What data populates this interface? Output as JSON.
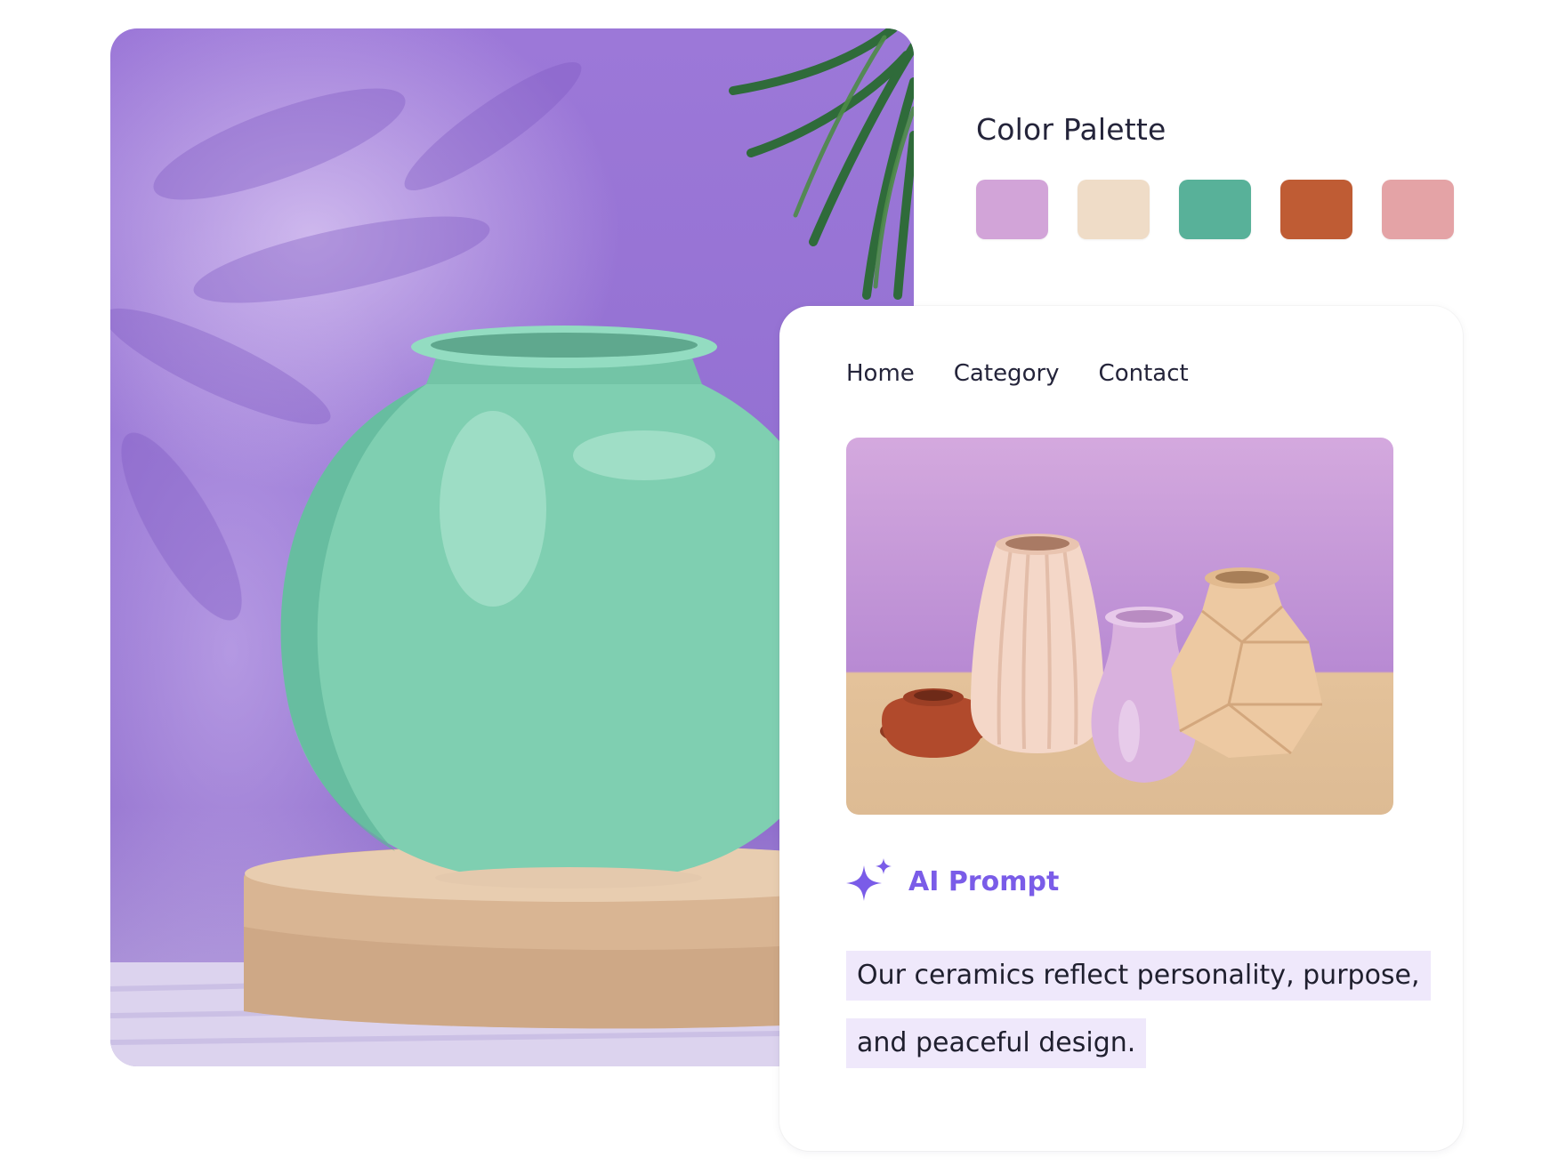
{
  "palette": {
    "title": "Color Palette",
    "colors": [
      "#d2a4d8",
      "#efdcc7",
      "#58b199",
      "#bf5c34",
      "#e4a3a6"
    ]
  },
  "nav": {
    "home": "Home",
    "category": "Category",
    "contact": "Contact"
  },
  "ai": {
    "label": "AI Prompt",
    "sparkle_icon": "sparkle-icon",
    "accent": "#7a5ce8"
  },
  "prompt": {
    "line1": "Our ceramics reflect personality, purpose,",
    "line2": "and peaceful design."
  }
}
